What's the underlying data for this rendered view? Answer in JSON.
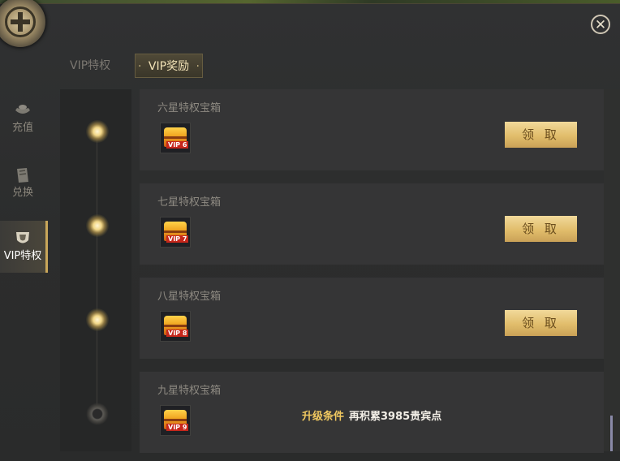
{
  "tabs": [
    {
      "label": "VIP特权"
    },
    {
      "label": "VIP奖励"
    }
  ],
  "sidebar": {
    "items": [
      {
        "label": "充值",
        "icon": "ingot-icon"
      },
      {
        "label": "兑换",
        "icon": "scroll-icon"
      },
      {
        "label": "VIP特权",
        "icon": "shield-icon"
      }
    ]
  },
  "rewards": [
    {
      "title": "六星特权宝箱",
      "vip": "VIP 6",
      "button": "领 取"
    },
    {
      "title": "七星特权宝箱",
      "vip": "VIP 7",
      "button": "领 取"
    },
    {
      "title": "八星特权宝箱",
      "vip": "VIP 8",
      "button": "领 取"
    },
    {
      "title": "九星特权宝箱",
      "vip": "VIP 9",
      "condition_label": "升级条件",
      "condition_text": "再积累3985贵宾点"
    }
  ],
  "colors": {
    "accent": "#e1bd6b",
    "condition": "#f0c860",
    "panel": "#353536"
  }
}
